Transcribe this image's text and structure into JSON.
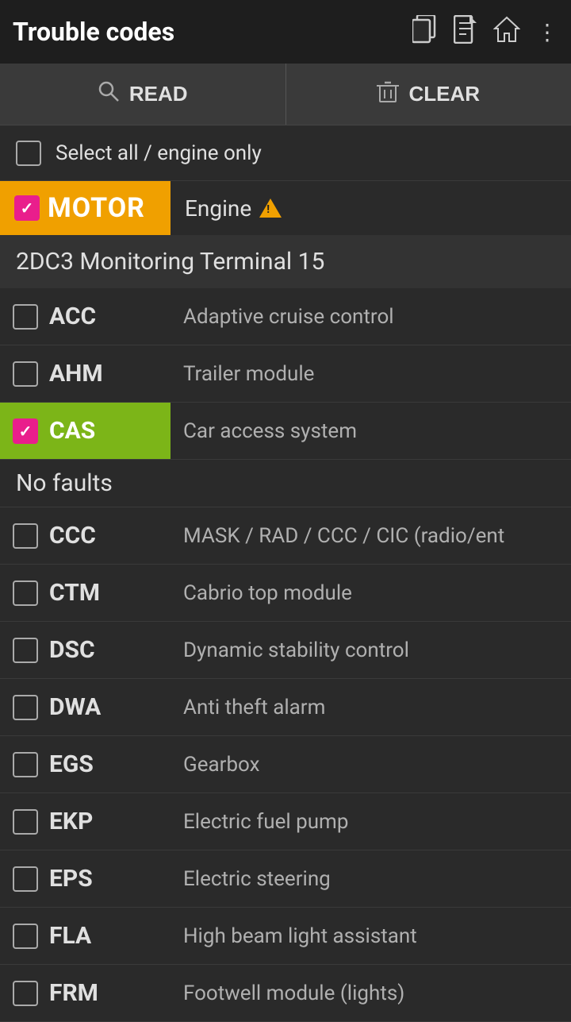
{
  "header": {
    "title": "Trouble codes",
    "icons": [
      "copy-icon",
      "document-icon",
      "home-icon",
      "more-icon"
    ]
  },
  "actionBar": {
    "readLabel": "READ",
    "clearLabel": "CLEAR"
  },
  "selectAll": {
    "label": "Select all / engine only",
    "checked": false
  },
  "motorSection": {
    "code": "MOTOR",
    "description": "Engine",
    "checked": true,
    "hasWarning": true
  },
  "sectionTitle": "2DC3 Monitoring Terminal 15",
  "noFaults": "No faults",
  "listItems": [
    {
      "code": "ACC",
      "description": "Adaptive cruise control",
      "checked": false,
      "casSelected": false
    },
    {
      "code": "AHM",
      "description": "Trailer module",
      "checked": false,
      "casSelected": false
    },
    {
      "code": "CAS",
      "description": "Car access system",
      "checked": true,
      "casSelected": true
    },
    {
      "code": "CCC",
      "description": "MASK / RAD / CCC / CIC (radio/ent",
      "checked": false,
      "casSelected": false
    },
    {
      "code": "CTM",
      "description": "Cabrio top module",
      "checked": false,
      "casSelected": false
    },
    {
      "code": "DSC",
      "description": "Dynamic stability control",
      "checked": false,
      "casSelected": false
    },
    {
      "code": "DWA",
      "description": "Anti theft alarm",
      "checked": false,
      "casSelected": false
    },
    {
      "code": "EGS",
      "description": "Gearbox",
      "checked": false,
      "casSelected": false
    },
    {
      "code": "EKP",
      "description": "Electric fuel pump",
      "checked": false,
      "casSelected": false
    },
    {
      "code": "EPS",
      "description": "Electric steering",
      "checked": false,
      "casSelected": false
    },
    {
      "code": "FLA",
      "description": "High beam light assistant",
      "checked": false,
      "casSelected": false
    },
    {
      "code": "FRM",
      "description": "Footwell module (lights)",
      "checked": false,
      "casSelected": false
    }
  ]
}
